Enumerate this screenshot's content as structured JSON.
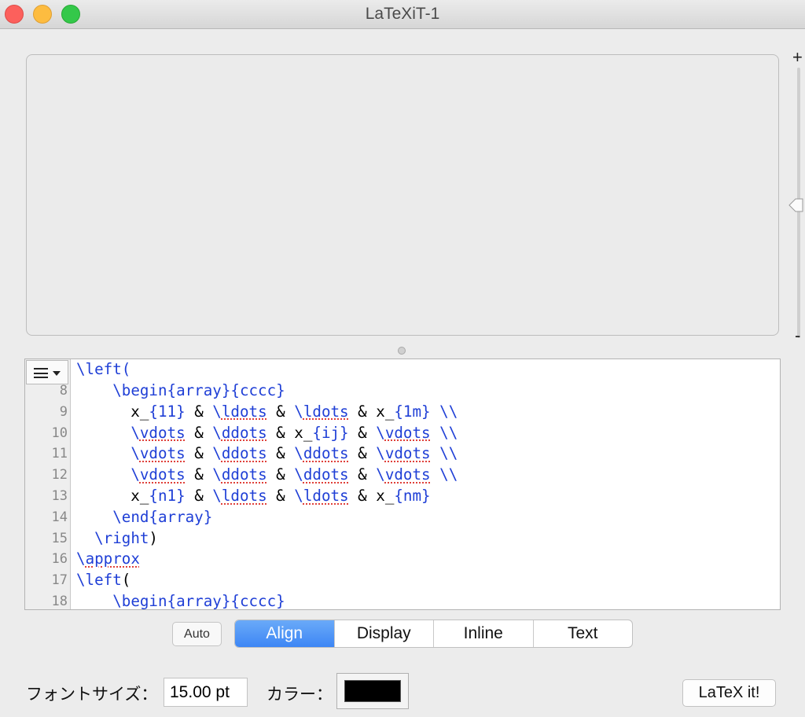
{
  "window": {
    "title": "LaTeXiT-1"
  },
  "zoom": {
    "plus": "+",
    "minus": "-",
    "level": 0.49
  },
  "editor": {
    "first_line": "\\left(",
    "lines": [
      {
        "n": "8",
        "segs": [
          {
            "t": "    "
          },
          {
            "t": "\\begin{array}{cccc}",
            "c": "cmd"
          }
        ]
      },
      {
        "n": "9",
        "segs": [
          {
            "t": "      x_"
          },
          {
            "t": "{11}",
            "c": "cmd"
          },
          {
            "t": " & "
          },
          {
            "t": "\\",
            "c": "cmd"
          },
          {
            "t": "ldots",
            "c": "cmd sp"
          },
          {
            "t": " & "
          },
          {
            "t": "\\",
            "c": "cmd"
          },
          {
            "t": "ldots",
            "c": "cmd sp"
          },
          {
            "t": " & x_"
          },
          {
            "t": "{1m}",
            "c": "cmd"
          },
          {
            "t": " "
          },
          {
            "t": "\\\\",
            "c": "cmd"
          }
        ]
      },
      {
        "n": "10",
        "segs": [
          {
            "t": "      "
          },
          {
            "t": "\\",
            "c": "cmd"
          },
          {
            "t": "vdots",
            "c": "cmd sp"
          },
          {
            "t": " & "
          },
          {
            "t": "\\",
            "c": "cmd"
          },
          {
            "t": "ddots",
            "c": "cmd sp"
          },
          {
            "t": " & x_"
          },
          {
            "t": "{ij}",
            "c": "cmd"
          },
          {
            "t": " & "
          },
          {
            "t": "\\",
            "c": "cmd"
          },
          {
            "t": "vdots",
            "c": "cmd sp"
          },
          {
            "t": " "
          },
          {
            "t": "\\\\",
            "c": "cmd"
          }
        ]
      },
      {
        "n": "11",
        "segs": [
          {
            "t": "      "
          },
          {
            "t": "\\",
            "c": "cmd"
          },
          {
            "t": "vdots",
            "c": "cmd sp"
          },
          {
            "t": " & "
          },
          {
            "t": "\\",
            "c": "cmd"
          },
          {
            "t": "ddots",
            "c": "cmd sp"
          },
          {
            "t": " & "
          },
          {
            "t": "\\",
            "c": "cmd"
          },
          {
            "t": "ddots",
            "c": "cmd sp"
          },
          {
            "t": " & "
          },
          {
            "t": "\\",
            "c": "cmd"
          },
          {
            "t": "vdots",
            "c": "cmd sp"
          },
          {
            "t": " "
          },
          {
            "t": "\\\\",
            "c": "cmd"
          }
        ]
      },
      {
        "n": "12",
        "segs": [
          {
            "t": "      "
          },
          {
            "t": "\\",
            "c": "cmd"
          },
          {
            "t": "vdots",
            "c": "cmd sp"
          },
          {
            "t": " & "
          },
          {
            "t": "\\",
            "c": "cmd"
          },
          {
            "t": "ddots",
            "c": "cmd sp"
          },
          {
            "t": " & "
          },
          {
            "t": "\\",
            "c": "cmd"
          },
          {
            "t": "ddots",
            "c": "cmd sp"
          },
          {
            "t": " & "
          },
          {
            "t": "\\",
            "c": "cmd"
          },
          {
            "t": "vdots",
            "c": "cmd sp"
          },
          {
            "t": " "
          },
          {
            "t": "\\\\",
            "c": "cmd"
          }
        ]
      },
      {
        "n": "13",
        "segs": [
          {
            "t": "      x_"
          },
          {
            "t": "{n1}",
            "c": "cmd"
          },
          {
            "t": " & "
          },
          {
            "t": "\\",
            "c": "cmd"
          },
          {
            "t": "ldots",
            "c": "cmd sp"
          },
          {
            "t": " & "
          },
          {
            "t": "\\",
            "c": "cmd"
          },
          {
            "t": "ldots",
            "c": "cmd sp"
          },
          {
            "t": " & x_"
          },
          {
            "t": "{nm}",
            "c": "cmd"
          }
        ]
      },
      {
        "n": "14",
        "segs": [
          {
            "t": "    "
          },
          {
            "t": "\\end{array}",
            "c": "cmd"
          }
        ]
      },
      {
        "n": "15",
        "segs": [
          {
            "t": "  "
          },
          {
            "t": "\\right",
            "c": "cmd"
          },
          {
            "t": ")"
          }
        ]
      },
      {
        "n": "16",
        "segs": [
          {
            "t": "\\",
            "c": "cmd"
          },
          {
            "t": "approx",
            "c": "cmd sp"
          }
        ]
      },
      {
        "n": "17",
        "segs": [
          {
            "t": "\\left",
            "c": "cmd"
          },
          {
            "t": "("
          }
        ]
      },
      {
        "n": "18",
        "segs": [
          {
            "t": "    "
          },
          {
            "t": "\\begin{array}{cccc}",
            "c": "cmd"
          }
        ]
      }
    ]
  },
  "mode": {
    "auto_label": "Auto",
    "segments": [
      "Align",
      "Display",
      "Inline",
      "Text"
    ],
    "selected": "Align"
  },
  "footer": {
    "font_size_label": "フォントサイズ：",
    "font_size_value": "15.00 pt",
    "color_label": "カラー：",
    "color_value": "#000000",
    "latex_button": "LaTeX it!"
  },
  "colors": {
    "command": "#1f3fd6",
    "accent": "#3d86f5"
  }
}
